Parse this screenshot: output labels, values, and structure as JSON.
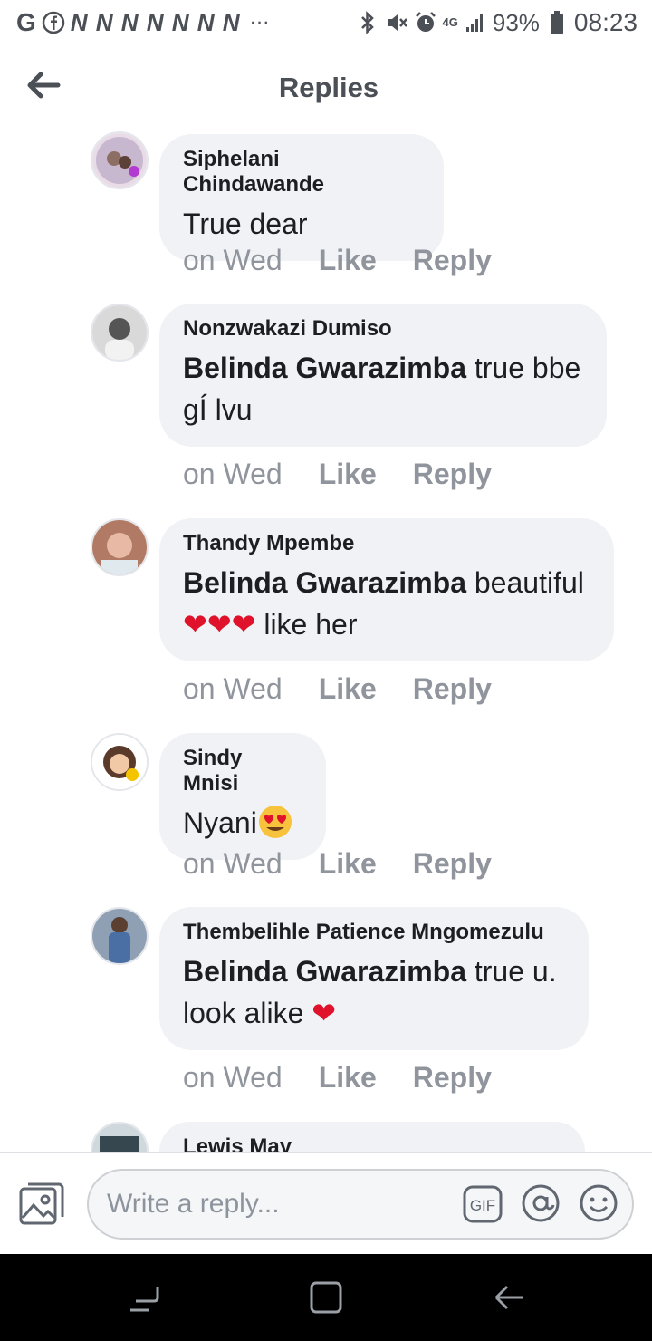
{
  "status_bar": {
    "left_g": "G",
    "notif_letters": "N N N N N N N",
    "more": "⋯",
    "network": "4G",
    "battery_pct": "93%",
    "time": "08:23"
  },
  "header": {
    "title": "Replies"
  },
  "comments": [
    {
      "author": "Siphelani Chindawande",
      "mention": "",
      "text": "True  dear",
      "time": "on Wed",
      "like": "Like",
      "reply": "Reply"
    },
    {
      "author": "Nonzwakazi Dumiso",
      "mention": "Belinda Gwarazimba",
      "text": " true bbe gÍ lvu",
      "time": "on Wed",
      "like": "Like",
      "reply": "Reply"
    },
    {
      "author": "Thandy Mpembe",
      "mention": "Belinda Gwarazimba",
      "text": " beautiful",
      "text2": " like her",
      "time": "on Wed",
      "like": "Like",
      "reply": "Reply"
    },
    {
      "author": "Sindy Mnisi",
      "mention": "",
      "text": "Nyani",
      "time": "on Wed",
      "like": "Like",
      "reply": "Reply"
    },
    {
      "author": "Thembelihle Patience Mngomezulu",
      "mention": "Belinda Gwarazimba",
      "text": "  true u. look alike",
      "time": "on Wed",
      "like": "Like",
      "reply": "Reply"
    },
    {
      "author": "Lewis May",
      "mention": "",
      "text": ""
    }
  ],
  "reply_bar": {
    "placeholder": "Write a reply...",
    "gif_label": "GIF"
  },
  "colors": {
    "bubble": "#f0f2f5",
    "muted_text": "#90949c",
    "heart": "#e0112b"
  }
}
